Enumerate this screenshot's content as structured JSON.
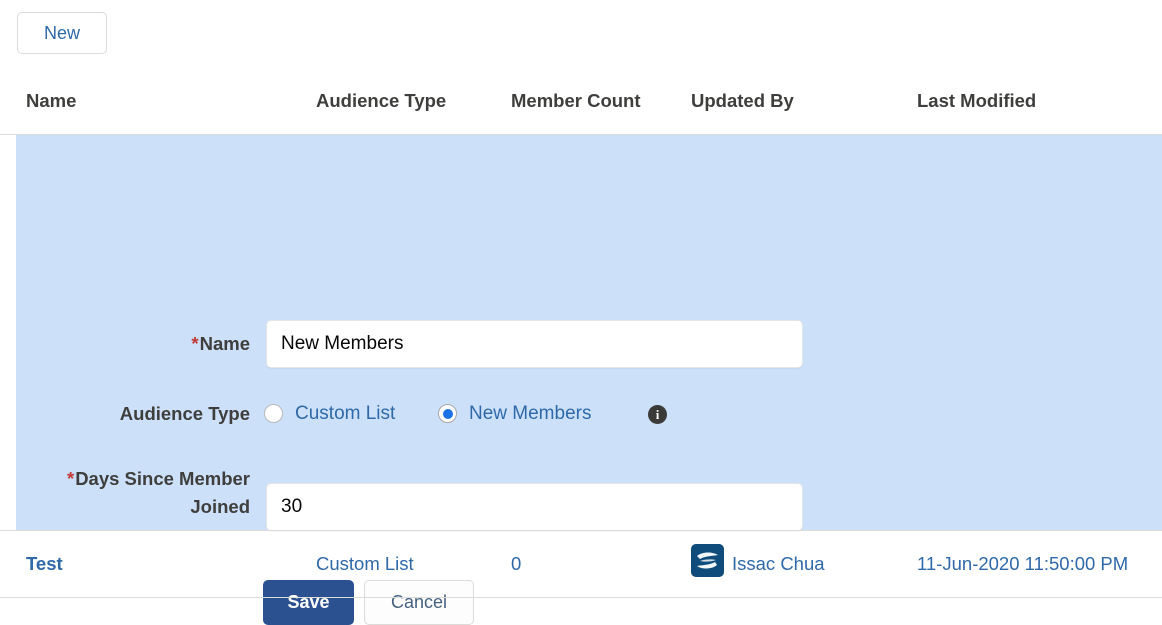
{
  "toolbar": {
    "new_label": "New"
  },
  "table": {
    "columns": [
      {
        "key": "name",
        "label": "Name"
      },
      {
        "key": "audience_type",
        "label": "Audience Type"
      },
      {
        "key": "member_count",
        "label": "Member Count"
      },
      {
        "key": "updated_by",
        "label": "Updated By"
      },
      {
        "key": "last_modified",
        "label": "Last Modified"
      }
    ],
    "rows": [
      {
        "name": "Test",
        "audience_type": "Custom List",
        "member_count": "0",
        "updated_by": "Issac Chua",
        "updated_by_avatar": "user-avatar-icon",
        "last_modified": "11-Jun-2020 11:50:00 PM"
      }
    ]
  },
  "edit_form": {
    "name_field": {
      "label": "Name",
      "required_mark": "*",
      "value": "New Members",
      "placeholder": ""
    },
    "audience_type_field": {
      "label": "Audience Type",
      "options": [
        {
          "label": "Custom List",
          "selected": false
        },
        {
          "label": "New Members",
          "selected": true
        }
      ],
      "info_icon": "info-icon",
      "info_icon_glyph": "i"
    },
    "days_field": {
      "label_line1": "Days Since Member",
      "label_line2": "Joined",
      "required_mark": "*",
      "value": "30",
      "placeholder": ""
    },
    "save_label": "Save",
    "cancel_label": "Cancel"
  },
  "colors": {
    "panel_background": "#cce0fa",
    "link": "#2f69a8",
    "save_button": "#2b5190",
    "required_star": "#c23934",
    "radio_selected": "#1b72e8",
    "info_icon_bg": "#3a3a38",
    "avatar_bg": "#0f4c7c",
    "border": "#dddbda"
  }
}
